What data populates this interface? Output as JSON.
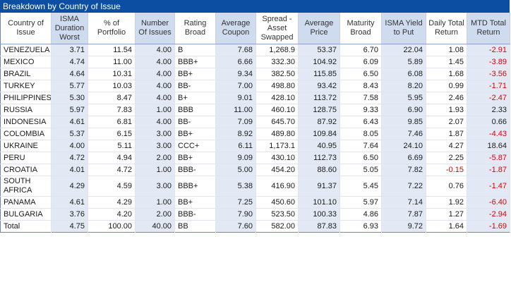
{
  "title": "Breakdown by Country of Issue",
  "columns": [
    {
      "label": "Country of Issue",
      "key": "country",
      "align": "left",
      "shaded": false,
      "width": 72
    },
    {
      "label": "ISMA Duration Worst",
      "key": "dur",
      "align": "right",
      "shaded": true,
      "width": 52
    },
    {
      "label": "% of Portfolio",
      "key": "pct",
      "align": "right",
      "shaded": false,
      "width": 67
    },
    {
      "label": "Number Of Issues",
      "key": "issues",
      "align": "right",
      "shaded": true,
      "width": 56
    },
    {
      "label": "Rating Broad",
      "key": "rating",
      "align": "left",
      "shaded": false,
      "width": 58
    },
    {
      "label": "Average Coupon",
      "key": "coupon",
      "align": "right",
      "shaded": true,
      "width": 57
    },
    {
      "label": "Spread - Asset Swapped",
      "key": "spread",
      "align": "right",
      "shaded": false,
      "width": 60
    },
    {
      "label": "Average Price",
      "key": "price",
      "align": "right",
      "shaded": true,
      "width": 59
    },
    {
      "label": "Maturity Broad",
      "key": "maturity",
      "align": "right",
      "shaded": false,
      "width": 59
    },
    {
      "label": "ISMA Yield to Put",
      "key": "yield",
      "align": "right",
      "shaded": true,
      "width": 63
    },
    {
      "label": "Daily Total Return",
      "key": "daily",
      "align": "right",
      "shaded": false,
      "width": 58
    },
    {
      "label": "MTD Total Return",
      "key": "mtd",
      "align": "right",
      "shaded": true,
      "width": 61
    }
  ],
  "rows": [
    {
      "country": "VENEZUELA",
      "dur": "3.71",
      "pct": "11.54",
      "issues": "4.00",
      "rating": "B",
      "coupon": "7.68",
      "spread": "1,268.9",
      "price": "53.37",
      "maturity": "6.70",
      "yield": "22.04",
      "daily": "1.08",
      "mtd": "-2.91"
    },
    {
      "country": "MEXICO",
      "dur": "4.74",
      "pct": "11.00",
      "issues": "4.00",
      "rating": "BBB+",
      "coupon": "6.66",
      "spread": "332.30",
      "price": "104.92",
      "maturity": "6.09",
      "yield": "5.89",
      "daily": "1.45",
      "mtd": "-3.89"
    },
    {
      "country": "BRAZIL",
      "dur": "4.64",
      "pct": "10.31",
      "issues": "4.00",
      "rating": "BB+",
      "coupon": "9.34",
      "spread": "382.50",
      "price": "115.85",
      "maturity": "6.50",
      "yield": "6.08",
      "daily": "1.68",
      "mtd": "-3.56"
    },
    {
      "country": "TURKEY",
      "dur": "5.77",
      "pct": "10.03",
      "issues": "4.00",
      "rating": "BB-",
      "coupon": "7.00",
      "spread": "498.80",
      "price": "93.42",
      "maturity": "8.43",
      "yield": "8.20",
      "daily": "0.99",
      "mtd": "-1.71"
    },
    {
      "country": "PHILIPPINES",
      "dur": "5.30",
      "pct": "8.47",
      "issues": "4.00",
      "rating": "B+",
      "coupon": "9.01",
      "spread": "428.10",
      "price": "113.72",
      "maturity": "7.58",
      "yield": "5.95",
      "daily": "2.46",
      "mtd": "-2.47"
    },
    {
      "country": "RUSSIA",
      "dur": "5.97",
      "pct": "7.83",
      "issues": "1.00",
      "rating": "BBB",
      "coupon": "11.00",
      "spread": "460.10",
      "price": "128.75",
      "maturity": "9.33",
      "yield": "6.90",
      "daily": "1.93",
      "mtd": "2.33"
    },
    {
      "country": "INDONESIA",
      "dur": "4.61",
      "pct": "6.81",
      "issues": "4.00",
      "rating": "BB-",
      "coupon": "7.09",
      "spread": "645.70",
      "price": "87.92",
      "maturity": "6.43",
      "yield": "9.85",
      "daily": "2.07",
      "mtd": "0.66"
    },
    {
      "country": "COLOMBIA",
      "dur": "5.37",
      "pct": "6.15",
      "issues": "3.00",
      "rating": "BB+",
      "coupon": "8.92",
      "spread": "489.80",
      "price": "109.84",
      "maturity": "8.05",
      "yield": "7.46",
      "daily": "1.87",
      "mtd": "-4.43"
    },
    {
      "country": "UKRAINE",
      "dur": "4.00",
      "pct": "5.11",
      "issues": "3.00",
      "rating": "CCC+",
      "coupon": "6.11",
      "spread": "1,173.1",
      "price": "40.95",
      "maturity": "7.64",
      "yield": "24.10",
      "daily": "4.27",
      "mtd": "18.64"
    },
    {
      "country": "PERU",
      "dur": "4.72",
      "pct": "4.94",
      "issues": "2.00",
      "rating": "BB+",
      "coupon": "9.09",
      "spread": "430.10",
      "price": "112.73",
      "maturity": "6.50",
      "yield": "6.69",
      "daily": "2.25",
      "mtd": "-5.87"
    },
    {
      "country": "CROATIA",
      "dur": "4.01",
      "pct": "4.72",
      "issues": "1.00",
      "rating": "BBB-",
      "coupon": "5.00",
      "spread": "454.20",
      "price": "88.60",
      "maturity": "5.05",
      "yield": "7.82",
      "daily": "-0.15",
      "mtd": "-1.87"
    },
    {
      "country": "SOUTH AFRICA",
      "dur": "4.29",
      "pct": "4.59",
      "issues": "3.00",
      "rating": "BBB+",
      "coupon": "5.38",
      "spread": "416.90",
      "price": "91.37",
      "maturity": "5.45",
      "yield": "7.22",
      "daily": "0.76",
      "mtd": "-1.47"
    },
    {
      "country": "PANAMA",
      "dur": "4.61",
      "pct": "4.29",
      "issues": "1.00",
      "rating": "BB+",
      "coupon": "7.25",
      "spread": "450.60",
      "price": "101.10",
      "maturity": "5.97",
      "yield": "7.14",
      "daily": "1.92",
      "mtd": "-6.40"
    },
    {
      "country": "BULGARIA",
      "dur": "3.76",
      "pct": "4.20",
      "issues": "2.00",
      "rating": "BBB-",
      "coupon": "7.90",
      "spread": "523.50",
      "price": "100.33",
      "maturity": "4.86",
      "yield": "7.87",
      "daily": "1.27",
      "mtd": "-2.94"
    },
    {
      "country": "Total",
      "dur": "4.75",
      "pct": "100.00",
      "issues": "40.00",
      "rating": "BB",
      "coupon": "7.60",
      "spread": "582.00",
      "price": "87.83",
      "maturity": "6.93",
      "yield": "9.72",
      "daily": "1.64",
      "mtd": "-1.69"
    }
  ],
  "colors": {
    "title_bg": "#0b4ea2",
    "shaded_col": "#e3e9f4",
    "negative": "#d90000"
  }
}
